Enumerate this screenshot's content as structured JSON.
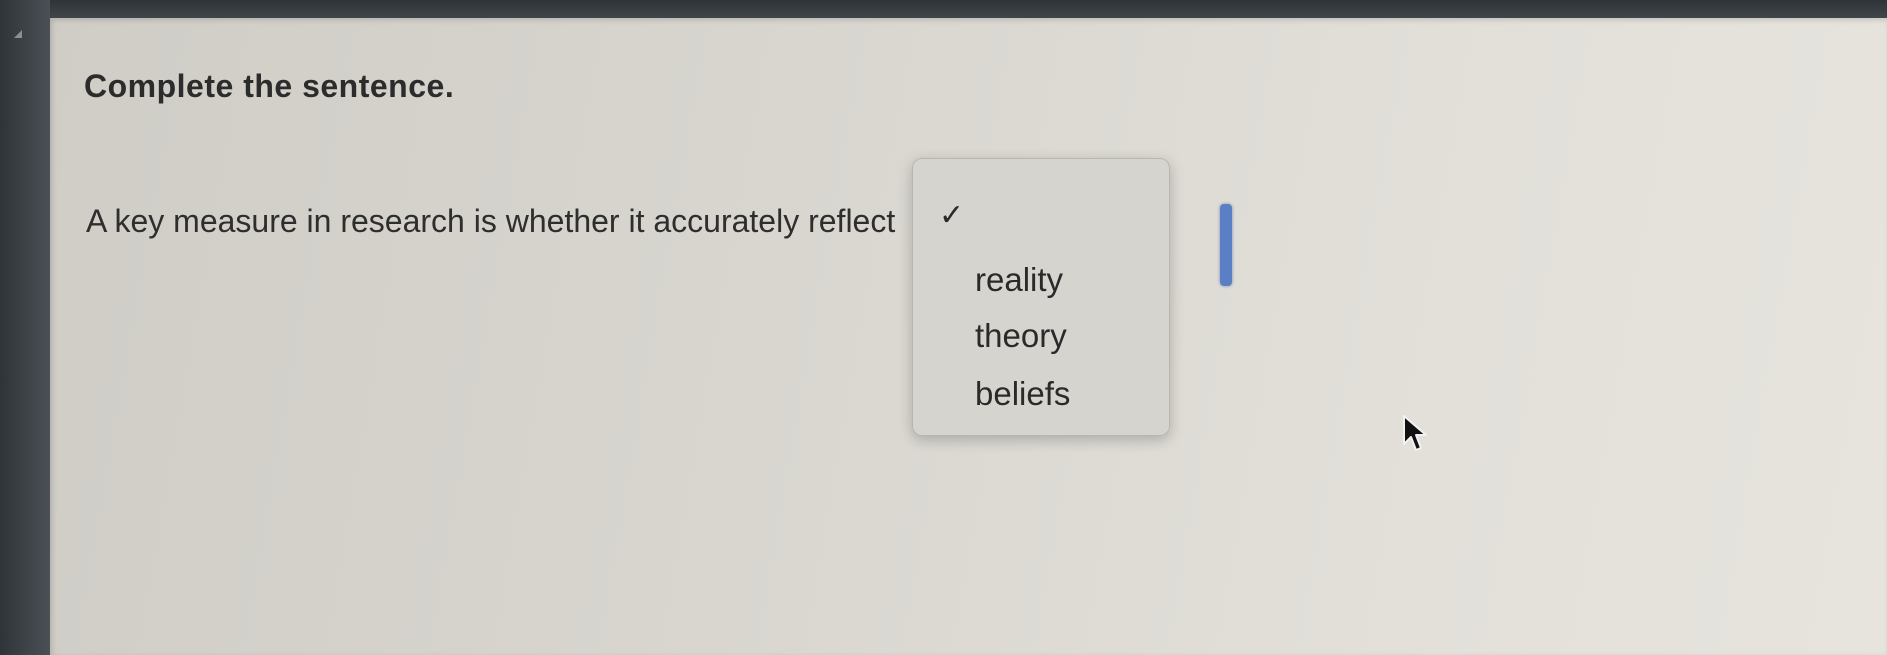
{
  "question": {
    "title": "Complete the sentence.",
    "sentence_prefix": "A key measure in research is whether it accurately reflect"
  },
  "dropdown": {
    "selected_marker": "✓",
    "options": [
      {
        "label": ""
      },
      {
        "label": "reality"
      },
      {
        "label": "theory"
      },
      {
        "label": "beliefs"
      }
    ]
  },
  "icons": {
    "checkmark": "checkmark-icon",
    "cursor": "mouse-pointer-icon"
  },
  "colors": {
    "panel_background": "#d8d6cf",
    "select_focus": "#5b7fc4",
    "text": "#2c2c2c"
  }
}
